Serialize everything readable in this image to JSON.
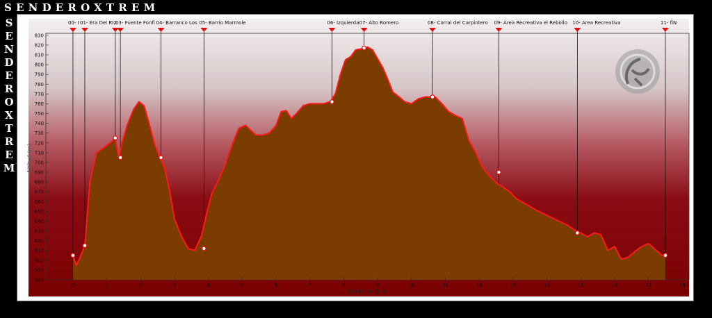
{
  "brand": {
    "name": "SENDEROXTREM"
  },
  "chart_data": {
    "type": "area",
    "xlabel": "Distancia (km)",
    "ylabel": "Altitud (m)",
    "xlim": [
      -0.8,
      18.2
    ],
    "ylim": [
      580,
      832
    ],
    "xticks": [
      0,
      1,
      2,
      3,
      4,
      5,
      6,
      7,
      8,
      9,
      10,
      11,
      12,
      13,
      14,
      15,
      16,
      17,
      18
    ],
    "yticks": [
      830,
      820,
      810,
      800,
      790,
      780,
      770,
      760,
      750,
      740,
      730,
      720,
      710,
      700,
      690,
      680,
      670,
      660,
      650,
      640,
      630,
      620,
      610,
      600,
      590,
      580
    ],
    "series": [
      {
        "x": [
          0,
          0.1,
          0.2,
          0.35,
          0.5,
          0.7,
          0.9,
          1.1,
          1.25,
          1.35,
          1.45,
          1.6,
          1.8,
          1.95,
          2.1,
          2.25,
          2.4,
          2.55,
          2.7,
          2.85,
          3.0,
          3.2,
          3.4,
          3.6,
          3.8,
          3.95,
          4.1,
          4.3,
          4.5,
          4.7,
          4.9,
          5.1,
          5.25,
          5.4,
          5.6,
          5.8,
          6.0,
          6.15,
          6.3,
          6.45,
          6.6,
          6.8,
          7.0,
          7.2,
          7.4,
          7.6,
          7.75,
          7.9,
          8.05,
          8.2,
          8.35,
          8.5,
          8.7,
          8.85,
          9.0,
          9.15,
          9.3,
          9.45,
          9.6,
          9.8,
          10.0,
          10.2,
          10.4,
          10.55,
          10.7,
          10.9,
          11.1,
          11.3,
          11.5,
          11.7,
          11.9,
          12.05,
          12.2,
          12.4,
          12.55,
          12.7,
          12.9,
          13.1,
          13.4,
          13.7,
          14.0,
          14.3,
          14.6,
          14.9,
          15.0,
          15.2,
          15.4,
          15.6,
          15.8,
          16.0,
          16.2,
          16.4,
          16.6,
          16.8,
          17.0,
          17.2,
          17.4,
          17.5
        ],
        "y": [
          605,
          595,
          602,
          615,
          680,
          710,
          715,
          720,
          725,
          705,
          720,
          738,
          755,
          762,
          758,
          740,
          720,
          706,
          695,
          672,
          642,
          625,
          612,
          610,
          625,
          648,
          668,
          682,
          698,
          718,
          735,
          738,
          733,
          728,
          728,
          730,
          738,
          752,
          753,
          745,
          750,
          758,
          760,
          760,
          760,
          762,
          770,
          790,
          805,
          808,
          815,
          816,
          818,
          815,
          806,
          797,
          785,
          772,
          768,
          762,
          760,
          765,
          767,
          767,
          767,
          760,
          752,
          748,
          745,
          722,
          710,
          698,
          690,
          683,
          678,
          675,
          670,
          663,
          657,
          651,
          646,
          641,
          636,
          629,
          628,
          624,
          628,
          626,
          610,
          614,
          601,
          603,
          609,
          614,
          617,
          611,
          605,
          605
        ]
      }
    ],
    "waypoints": [
      {
        "label": "00- I",
        "x": 0,
        "y": 605
      },
      {
        "label": "01- Era Del F",
        "x": 0.35,
        "y": 615
      },
      {
        "label": "02",
        "x": 1.25,
        "y": 725
      },
      {
        "label": "03- Fuente Fonfi",
        "x": 1.4,
        "y": 705
      },
      {
        "label": "04- Barranco Los",
        "x": 2.6,
        "y": 705
      },
      {
        "label": "05- Barrio Marmole",
        "x": 3.87,
        "y": 612
      },
      {
        "label": "06- Izquierda",
        "x": 7.65,
        "y": 762
      },
      {
        "label": "07- Alto Romero",
        "x": 8.6,
        "y": 817
      },
      {
        "label": "08- Corral del Carpintero",
        "x": 10.62,
        "y": 767
      },
      {
        "label": "09- Area Recreativa el Rebollo",
        "x": 12.58,
        "y": 690
      },
      {
        "label": "10- Area Recreativa",
        "x": 14.9,
        "y": 628
      },
      {
        "label": "11- fiN",
        "x": 17.5,
        "y": 605
      }
    ],
    "grid": false,
    "colors": {
      "fill": "#7a3c00",
      "line": "#ff1a1a",
      "frame": "#000000"
    }
  }
}
